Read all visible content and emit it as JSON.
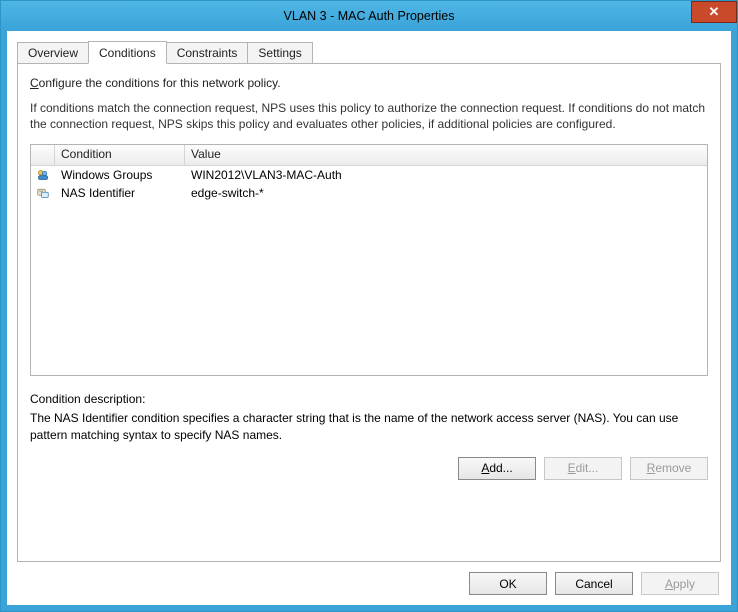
{
  "window": {
    "title": "VLAN 3 - MAC Auth Properties",
    "close_glyph": "✕"
  },
  "tabs": [
    {
      "label": "Overview"
    },
    {
      "label": "Conditions"
    },
    {
      "label": "Constraints"
    },
    {
      "label": "Settings"
    }
  ],
  "page": {
    "configure_prefix": "C",
    "configure_rest": "onfigure the conditions for this network policy.",
    "match_text": "If conditions match the connection request, NPS uses this policy to authorize the connection request. If conditions do not match the connection request, NPS skips this policy and evaluates other policies, if additional policies are configured.",
    "columns": {
      "condition": "Condition",
      "value": "Value"
    },
    "rows": [
      {
        "condition": "Windows Groups",
        "value": "WIN2012\\VLAN3-MAC-Auth",
        "icon": "windows-groups-icon"
      },
      {
        "condition": "NAS Identifier",
        "value": "edge-switch-*",
        "icon": "nas-identifier-icon"
      }
    ],
    "desc_label": "Condition description:",
    "desc_text": "The NAS Identifier condition specifies a character string that is the name of the network access server (NAS). You can use pattern matching syntax to specify NAS names.",
    "buttons": {
      "add_prefix": "A",
      "add_rest": "dd...",
      "edit_prefix": "E",
      "edit_rest": "dit...",
      "remove_prefix": "R",
      "remove_rest": "emove"
    }
  },
  "dialog_buttons": {
    "ok": "OK",
    "cancel": "Cancel",
    "apply_prefix": "A",
    "apply_rest": "pply"
  }
}
